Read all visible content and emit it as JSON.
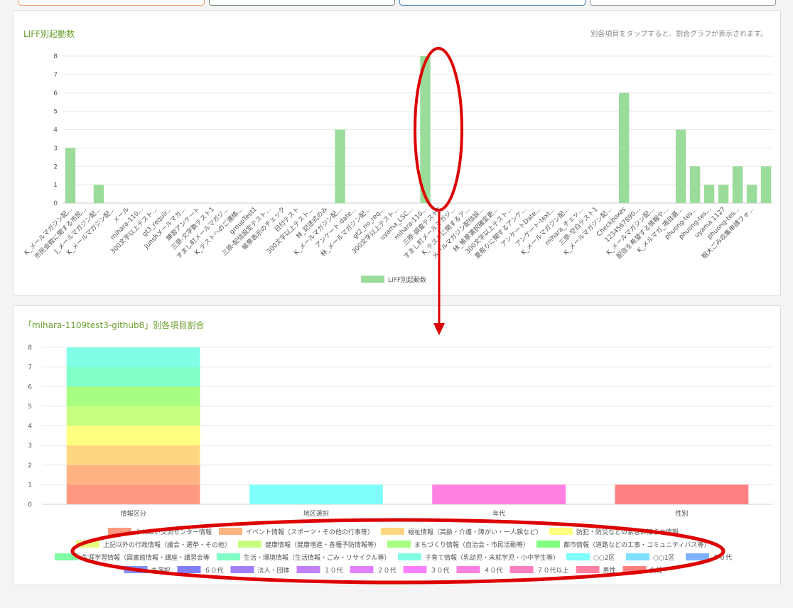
{
  "panel1": {
    "title": "LIFF別起動数",
    "hint": "別各項目をタップすると、割合グラフが表示されます。"
  },
  "panel2": {
    "title": "「mihara-1109test3-github8」別各項目割合"
  },
  "top_buttons_colors": [
    "#f0a070",
    "#6f8a6f",
    "#4a7fbf",
    "#9a9a9a"
  ],
  "annotation_color": "#dd0000",
  "chart_data": [
    {
      "type": "bar",
      "title": "",
      "xlabel": "",
      "ylabel": "",
      "ylim": [
        0,
        8
      ],
      "yticks": [
        0,
        1,
        2,
        3,
        4,
        5,
        6,
        7,
        8
      ],
      "grid": true,
      "legend": "bottom",
      "series": [
        {
          "name": "LIFF別起動数",
          "color": "#9bdc9b",
          "values": [
            3,
            0,
            1,
            0,
            0,
            0,
            0,
            0,
            0,
            0,
            0,
            0,
            0,
            0,
            0,
            0,
            0,
            0,
            0,
            4,
            0,
            0,
            0,
            0,
            0,
            8,
            0,
            0,
            0,
            0,
            0,
            0,
            0,
            0,
            0,
            0,
            0,
            0,
            0,
            6,
            0,
            0,
            0,
            4,
            2,
            1,
            1,
            2,
            1,
            2
          ]
        }
      ],
      "categories": [
        "K_メールマガジン配...",
        "市民会館に関する市民...",
        "J_メールマガジン配...",
        "K_メールマガジン配...",
        "メール",
        "mihara-110...",
        "300文字以上テスト...",
        "gt3_requir...",
        "Junshメールマガ...",
        "練習アンケート",
        "三原-文字数テスト1",
        "すまし町メールマガジ...",
        "K_テストへのご連絡...",
        "groupTest1",
        "三原-配信設定テスト...",
        "帳票表示のチェック",
        "日付テスト",
        "300文字以上テスト...",
        "林_記述式のみ",
        "K_メールマガジン配...",
        "アンケート-date...",
        "林_メールマガジン配...",
        "gt2_no_req...",
        "300文字以上テスト...",
        "uyama_LSC...",
        "mihara-110...",
        "三原-調査テスト1",
        "すまし町メールマガジ...",
        "K_テストに関するア...",
        "メールマガジン配信設...",
        "林_帳票選択確変更...",
        "300文字以上テスト...",
        "夏祭りに関するアンケ...",
        "アンケートDate...",
        "アンケート-text...",
        "K_メールマガジン配...",
        "mihara_チェッ...",
        "三原-空白テスト1",
        "K_メールマガジン配...",
        "Checkboxes",
        "1234567890...",
        "K_メールマガジン配...",
        "配信を希望する情報や...",
        "K_メルマガ_項目選...",
        "phuong-tes...",
        "phuong-tes...",
        "uyama 1127",
        "phuong-tes...",
        "粗大ごみ収集申請フォ...",
        ""
      ]
    },
    {
      "type": "bar",
      "stacked": true,
      "title": "「mihara-1109test3-github8」別各項目割合",
      "ylim": [
        0,
        8
      ],
      "yticks": [
        0,
        1,
        2,
        3,
        4,
        5,
        6,
        7,
        8
      ],
      "grid": true,
      "legend": "bottom",
      "categories": [
        "情報区分",
        "地区選択",
        "年代",
        "性別"
      ],
      "series": [
        {
          "name": "ふれあい交流センター情報",
          "color": "#ff9a80",
          "values": [
            1,
            0,
            0,
            0
          ]
        },
        {
          "name": "イベント情報（スポーツ・その他の行事等）",
          "color": "#ffb380",
          "values": [
            1,
            0,
            0,
            0
          ]
        },
        {
          "name": "福祉情報（高齢・介護・障がい・一人親など）",
          "color": "#ffd680",
          "values": [
            1,
            0,
            0,
            0
          ]
        },
        {
          "name": "防犯・防災などの緊急お知らせ情報",
          "color": "#ffff80",
          "values": [
            1,
            0,
            0,
            0
          ]
        },
        {
          "name": "上記以外の行政情報（議会・選挙・その他）",
          "color": "#e6ff80",
          "values": [
            0,
            0,
            0,
            0
          ]
        },
        {
          "name": "健康情報（健康増進・各種予防情報等）",
          "color": "#c6ff80",
          "values": [
            1,
            0,
            0,
            0
          ]
        },
        {
          "name": "まちづくり情報（自治会・市民活動等）",
          "color": "#a6ff80",
          "values": [
            1,
            0,
            0,
            0
          ]
        },
        {
          "name": "都市情報（道路などの工事・コミュニティバス等）",
          "color": "#80ff80",
          "values": [
            0,
            0,
            0,
            0
          ]
        },
        {
          "name": "生涯学習情報（図書館情報・講座・講習会等",
          "color": "#80ffa6",
          "values": [
            0,
            0,
            0,
            0
          ]
        },
        {
          "name": "生活・環境情報（生活情報・ごみ・リサイクル等）",
          "color": "#80ffc6",
          "values": [
            1,
            0,
            0,
            0
          ]
        },
        {
          "name": "子育て情報（乳幼児・未就学児・小中学生等）",
          "color": "#80ffe6",
          "values": [
            1,
            0,
            0,
            0
          ]
        },
        {
          "name": "○○2区",
          "color": "#80ffff",
          "values": [
            0,
            1,
            0,
            0
          ]
        },
        {
          "name": "○○1区",
          "color": "#80e0ff",
          "values": [
            0,
            0,
            0,
            0
          ]
        },
        {
          "name": "５０代",
          "color": "#80b3ff",
          "values": [
            0,
            0,
            0,
            0
          ]
        },
        {
          "name": "未選択",
          "color": "#8090ff",
          "values": [
            0,
            0,
            0,
            0
          ]
        },
        {
          "name": "６０代",
          "color": "#8080ff",
          "values": [
            0,
            0,
            0,
            0
          ]
        },
        {
          "name": "法人・団体",
          "color": "#a080ff",
          "values": [
            0,
            0,
            0,
            0
          ]
        },
        {
          "name": "１０代",
          "color": "#c080ff",
          "values": [
            0,
            0,
            0,
            0
          ]
        },
        {
          "name": "２０代",
          "color": "#e080ff",
          "values": [
            0,
            0,
            0,
            0
          ]
        },
        {
          "name": "３０代",
          "color": "#ff80ff",
          "values": [
            0,
            0,
            0,
            0
          ]
        },
        {
          "name": "４０代",
          "color": "#ff80e0",
          "values": [
            0,
            0,
            1,
            0
          ]
        },
        {
          "name": "７０代以上",
          "color": "#ff80c0",
          "values": [
            0,
            0,
            0,
            0
          ]
        },
        {
          "name": "男性",
          "color": "#ff80a0",
          "values": [
            0,
            0,
            0,
            0
          ]
        },
        {
          "name": "女性",
          "color": "#ff8080",
          "values": [
            0,
            0,
            0,
            1
          ]
        }
      ]
    }
  ]
}
